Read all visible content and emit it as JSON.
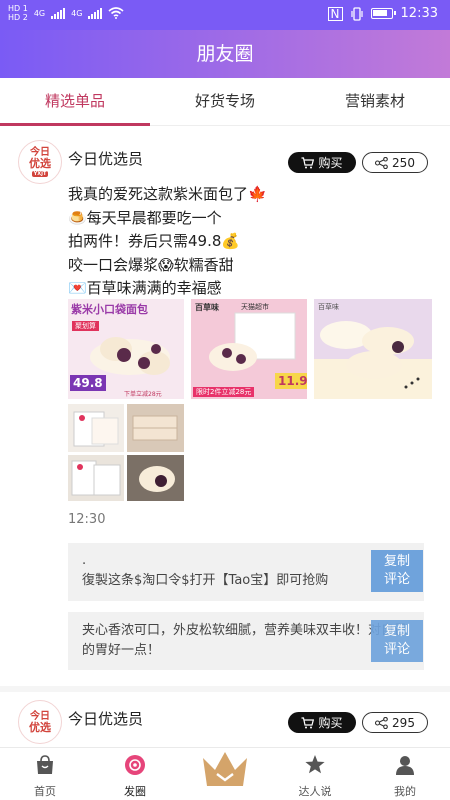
{
  "status_bar": {
    "sim1": "HD 1",
    "sim2": "HD 2",
    "net1": "4G",
    "net2": "4G",
    "nfc": "N",
    "time": "12:33"
  },
  "header": {
    "title": "朋友圈"
  },
  "tabs": [
    {
      "label": "精选单品",
      "active": true
    },
    {
      "label": "好货专场",
      "active": false
    },
    {
      "label": "营销素材",
      "active": false
    }
  ],
  "post": {
    "avatar_line1": "今日",
    "avatar_line2": "优选",
    "avatar_tag": "YXJT",
    "author": "今日优选员",
    "buy_label": "购买",
    "share_count": "250",
    "text_lines": [
      "我真的爱死这款紫米面包了🍁",
      "🍮每天早晨都要吃一个",
      "拍两件！券后只需49.8💰",
      "咬一口会爆浆😱软糯香甜",
      "💌百草味满满的幸福感"
    ],
    "images": {
      "img1_title": "紫米小口袋面包",
      "img1_badge": "聚划算",
      "img1_price": "49.8",
      "img1_note": "下单立减28元",
      "img2_brand": "百草味",
      "img2_tag": "天猫超市",
      "img2_price": "11.9",
      "img2_note": "限时2件立减28元",
      "img3_brand": "百草味"
    },
    "time": "12:30",
    "comments": [
      {
        "text": ".\n復製这条$淘口令$打开【Tao宝】即可抢购",
        "copy_label": "复制\n评论"
      },
      {
        "text": "夹心香浓可口，外皮松软细腻，营养美味双丰收！对自己的胃好一点！",
        "copy_label": "复制\n评论"
      }
    ]
  },
  "post2": {
    "avatar_line1": "今日",
    "avatar_line2": "优选",
    "author": "今日优选员",
    "buy_label": "购买",
    "share_count": "295"
  },
  "bottom_nav": [
    {
      "label": "首页",
      "icon": "home-bag-icon"
    },
    {
      "label": "发圈",
      "icon": "moments-icon",
      "active": true
    },
    {
      "label": "",
      "icon": "crown-icon"
    },
    {
      "label": "达人说",
      "icon": "star-icon"
    },
    {
      "label": "我的",
      "icon": "profile-icon"
    }
  ],
  "colors": {
    "accent": "#c0385f",
    "header_start": "#7a5bf5",
    "header_end": "#c27ad8",
    "copy_button": "#6fa3dc",
    "crown": "#d4a46a"
  }
}
